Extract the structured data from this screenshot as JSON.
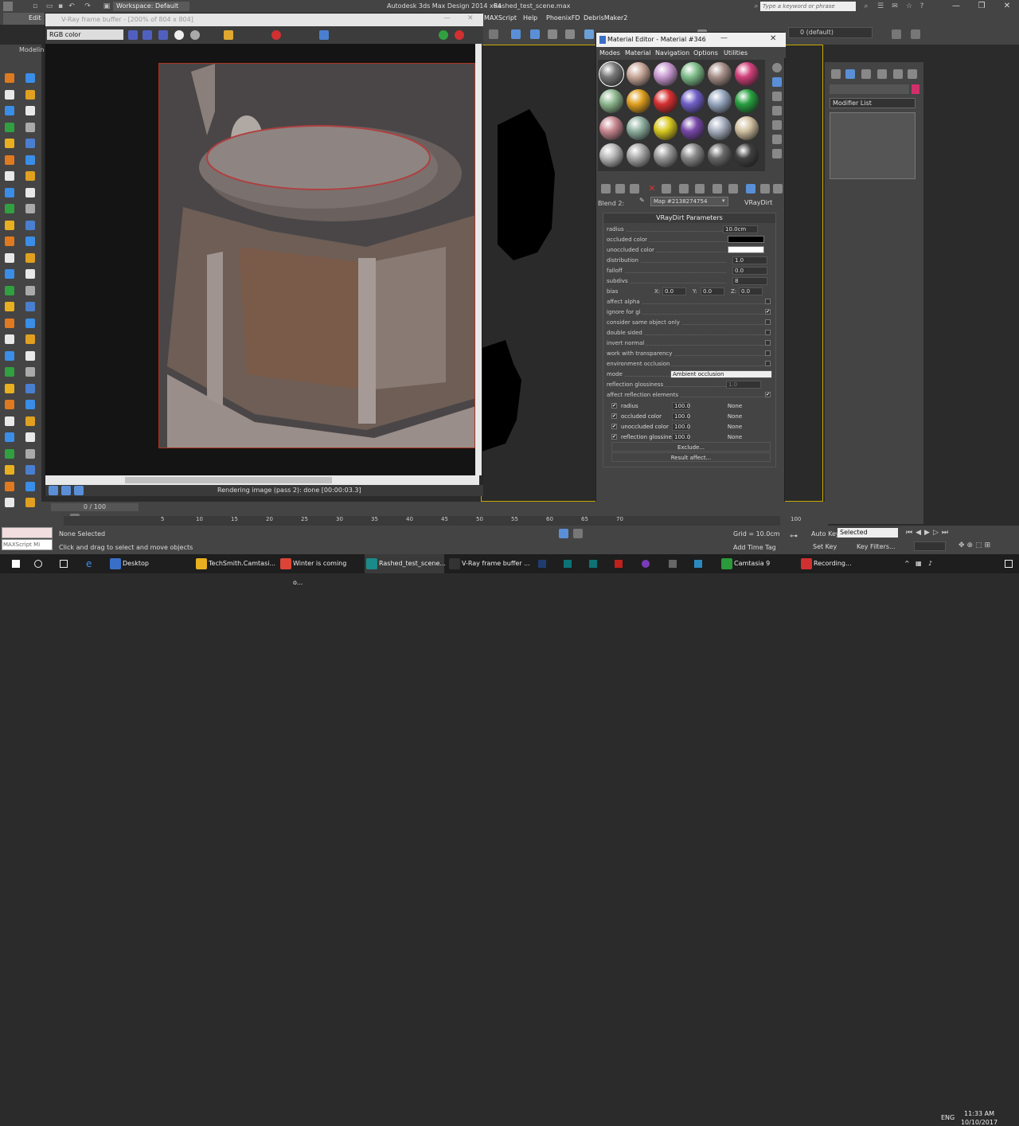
{
  "titlebar": {
    "workspace": "Workspace: Default",
    "app_title": "Autodesk 3ds Max Design 2014 x64",
    "file_title": "Rashed_test_scene.max",
    "search_placeholder": "Type a keyword or phrase"
  },
  "menubar": {
    "items": [
      "Edit",
      "MAXScript",
      "Help",
      "PhoenixFD",
      "DebrisMaker2"
    ]
  },
  "maintoolbar": {
    "layer": "0 (default)"
  },
  "left": {
    "modeling_tab": "Modeling"
  },
  "vfb": {
    "title": "V-Ray frame buffer - [200% of 804 x 804]",
    "channel": "RGB color",
    "status": "Rendering image (pass 2): done [00:00:03.3]"
  },
  "material_editor": {
    "title": "Material Editor - Material #346",
    "menu": [
      "Modes",
      "Material",
      "Navigation",
      "Options",
      "Utilities"
    ],
    "sphere_colors": [
      "#777777",
      "#c9a89a",
      "#c99ad2",
      "#7fbd8a",
      "#a8908a",
      "#d0407a",
      "#8fb88f",
      "#e0a020",
      "#d83030",
      "#7060c8",
      "#98a8c0",
      "#28a040",
      "#c88890",
      "#8fb0a0",
      "#d8c820",
      "#7848a8",
      "#a8b0c0",
      "#d0c0a0",
      "#b8b8b8",
      "#a8a8a8",
      "#989898",
      "#888888",
      "#686868",
      "#404040"
    ],
    "blend_label": "Blend 2:",
    "map_name": "Map #2138274754",
    "map_type": "VRayDirt",
    "rollout_title": "VRayDirt Parameters",
    "params": {
      "radius": {
        "label": "radius",
        "value": "10.0cm"
      },
      "occluded_color": {
        "label": "occluded color",
        "color": "#000000"
      },
      "unoccluded_color": {
        "label": "unoccluded color",
        "color": "#ffffff"
      },
      "distribution": {
        "label": "distribution",
        "value": "1.0"
      },
      "falloff": {
        "label": "falloff",
        "value": "0.0"
      },
      "subdivs": {
        "label": "subdivs",
        "value": "8"
      },
      "bias": {
        "label": "bias",
        "x_label": "X:",
        "x": "0.0",
        "y_label": "Y:",
        "y": "0.0",
        "z_label": "Z:",
        "z": "0.0"
      },
      "affect_alpha": {
        "label": "affect alpha",
        "checked": false
      },
      "ignore_for_gi": {
        "label": "ignore for gi",
        "checked": true
      },
      "consider_same": {
        "label": "consider same object only",
        "checked": false
      },
      "double_sided": {
        "label": "double sided",
        "checked": false
      },
      "invert_normal": {
        "label": "invert normal",
        "checked": false
      },
      "work_transparency": {
        "label": "work with transparency",
        "checked": false
      },
      "env_occlusion": {
        "label": "environment occlusion",
        "checked": false
      },
      "mode": {
        "label": "mode",
        "value": "Ambient occlusion"
      },
      "refl_gloss": {
        "label": "reflection glossiness",
        "value": "1.0"
      },
      "affect_refl": {
        "label": "affect reflection elements",
        "checked": true
      }
    },
    "submaps": [
      {
        "label": "radius",
        "amount": "100.0",
        "map": "None"
      },
      {
        "label": "occluded color",
        "amount": "100.0",
        "map": "None"
      },
      {
        "label": "unoccluded color",
        "amount": "100.0",
        "map": "None"
      },
      {
        "label": "reflection glossines",
        "amount": "100.0",
        "map": "None"
      }
    ],
    "exclude": "Exclude...",
    "result_affect": "Result affect..."
  },
  "command_panel": {
    "modifier_list": "Modifier List"
  },
  "timeline": {
    "frame": "0 / 100",
    "ticks": [
      "5",
      "10",
      "15",
      "20",
      "25",
      "30",
      "35",
      "40",
      "45",
      "50",
      "55",
      "60",
      "65",
      "70",
      "100"
    ]
  },
  "status": {
    "maxscript": "MAXScript Mi",
    "none_selected": "None Selected",
    "hint": "Click and drag to select and move objects",
    "grid": "Grid = 10.0cm",
    "add_time_tag": "Add Time Tag",
    "auto_key": "Auto Key",
    "set_key": "Set Key",
    "selected": "Selected",
    "key_filters": "Key Filters..."
  },
  "taskbar": {
    "items": [
      {
        "label": "Desktop",
        "color": "#3a6fc8"
      },
      {
        "label": "TechSmith.Camtasi...",
        "color": "#e8b020"
      },
      {
        "label": "Winter is coming o...",
        "color": "#db4437"
      },
      {
        "label": "Rashed_test_scene...",
        "color": "#1a8a8a"
      },
      {
        "label": "V-Ray frame buffer ...",
        "color": "#333333"
      },
      {
        "label": "Camtasia 9",
        "color": "#2a9a3a"
      },
      {
        "label": "Recording...",
        "color": "#d03030"
      }
    ],
    "lang": "ENG",
    "time": "11:33 AM",
    "date": "10/10/2017"
  }
}
